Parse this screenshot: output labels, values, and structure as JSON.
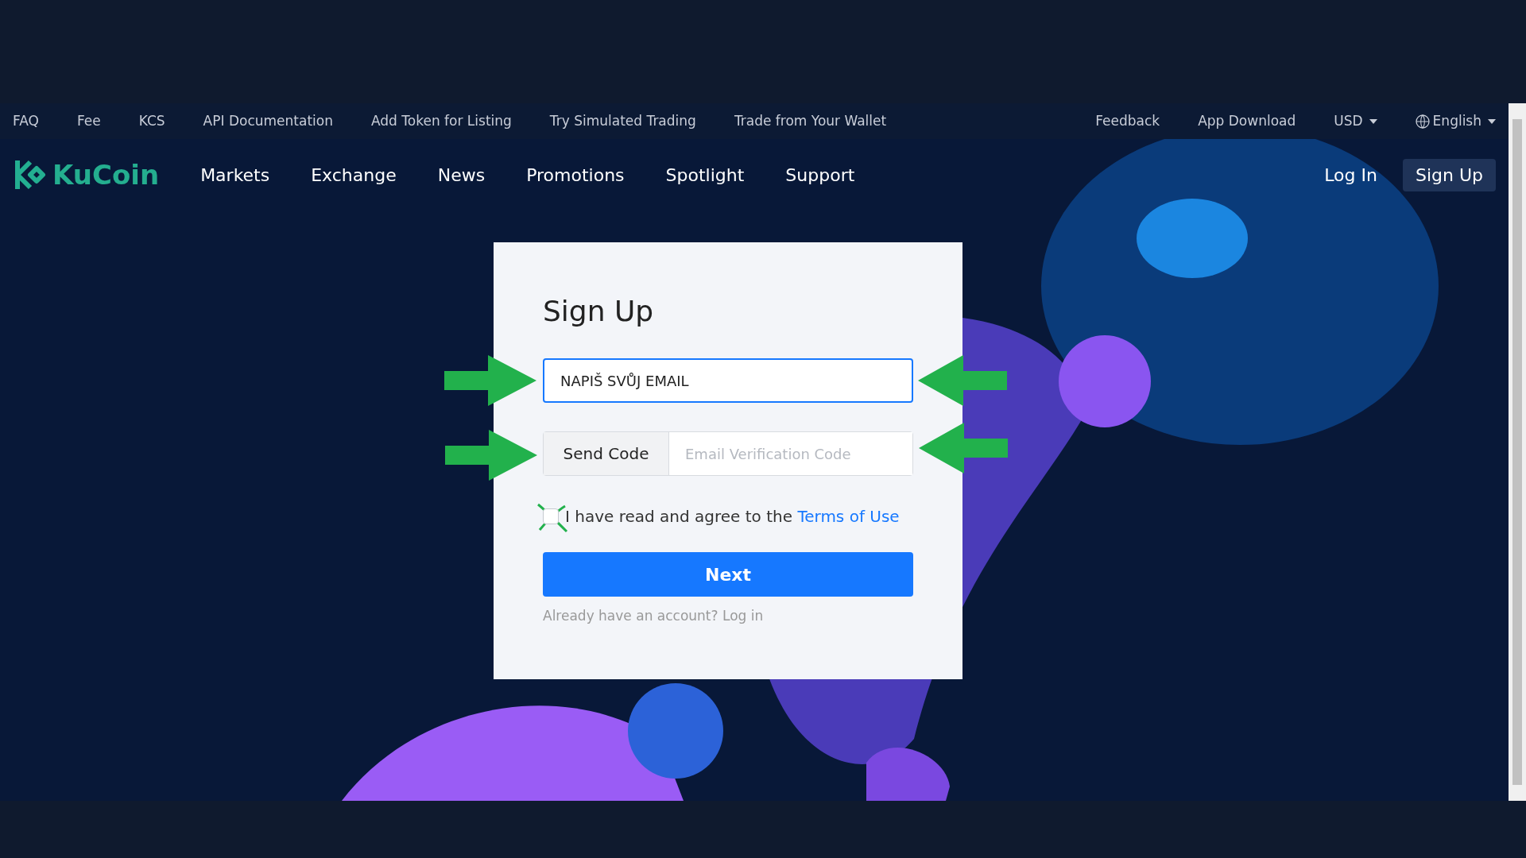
{
  "top_bar": {
    "links": [
      "FAQ",
      "Fee",
      "KCS",
      "API Documentation",
      "Add Token for Listing",
      "Try Simulated Trading",
      "Trade from Your Wallet"
    ],
    "right_links": [
      "Feedback",
      "App Download"
    ],
    "currency": "USD",
    "language": "English"
  },
  "nav": {
    "logo": "KuCoin",
    "items": [
      "Markets",
      "Exchange",
      "News",
      "Promotions",
      "Spotlight",
      "Support"
    ],
    "login": "Log In",
    "signup": "Sign Up"
  },
  "form": {
    "title": "Sign Up",
    "email": {
      "value": "NAPIŠ SVŮJ EMAIL"
    },
    "send_code": "Send Code",
    "code": {
      "placeholder": "Email Verification Code"
    },
    "agree": {
      "checked": false,
      "text": "I have read and agree to the",
      "link": "Terms of Use"
    },
    "next": "Next",
    "login_prompt": "Already have an account? Log in"
  }
}
